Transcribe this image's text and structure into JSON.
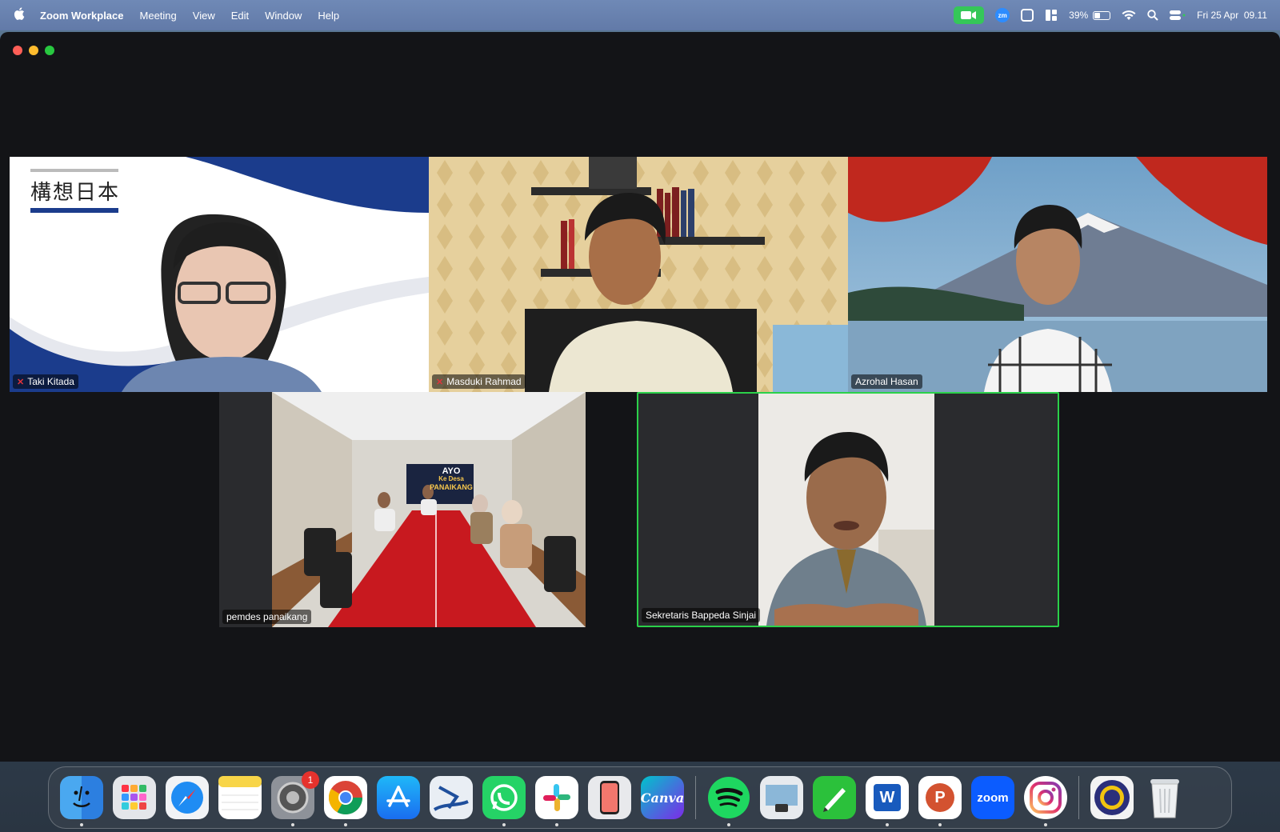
{
  "menubar": {
    "app_name": "Zoom Workplace",
    "items": [
      "Meeting",
      "View",
      "Edit",
      "Window",
      "Help"
    ],
    "status": {
      "zoom_indicator": "zm",
      "battery_percent": "39%",
      "battery_level": 0.39,
      "datetime": "Fri 25 Apr  09.11"
    }
  },
  "meeting": {
    "participants": [
      {
        "name": "Taki Kitada",
        "muted": true,
        "background_text": "構想日本"
      },
      {
        "name": "Masduki Rahmad",
        "muted": true
      },
      {
        "name": "Azrohal Hasan",
        "muted": false
      },
      {
        "name": "pemdes panaikang",
        "muted": false,
        "banner_text": [
          "AYO",
          "Ke Desa",
          "PANAIKANG"
        ]
      },
      {
        "name": "Sekretaris Bappeda Sinjai",
        "muted": false,
        "active_speaker": true
      }
    ]
  },
  "dock": {
    "apps": [
      {
        "name": "Finder",
        "label": ""
      },
      {
        "name": "Launchpad",
        "label": ""
      },
      {
        "name": "Safari",
        "label": ""
      },
      {
        "name": "Notes",
        "label": ""
      },
      {
        "name": "System Settings",
        "label": "",
        "badge": "1"
      },
      {
        "name": "Chrome",
        "label": ""
      },
      {
        "name": "App Store",
        "label": ""
      },
      {
        "name": "Ski app",
        "label": ""
      },
      {
        "name": "WhatsApp",
        "label": ""
      },
      {
        "name": "Slack",
        "label": ""
      },
      {
        "name": "iPhone Mirroring",
        "label": ""
      },
      {
        "name": "Canva",
        "label": "Canva"
      },
      {
        "name": "Spotify",
        "label": ""
      },
      {
        "name": "Preview",
        "label": ""
      },
      {
        "name": "Pen app",
        "label": ""
      },
      {
        "name": "Word",
        "label": "W"
      },
      {
        "name": "PowerPoint",
        "label": "P"
      },
      {
        "name": "Zoom",
        "label": "zoom"
      },
      {
        "name": "Instagram",
        "label": ""
      },
      {
        "name": "University logo",
        "label": ""
      },
      {
        "name": "Trash",
        "label": ""
      }
    ]
  }
}
